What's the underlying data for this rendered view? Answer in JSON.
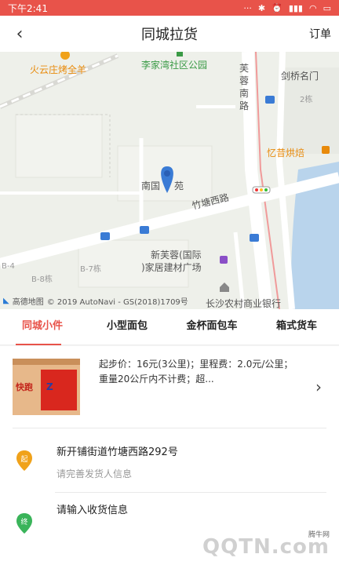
{
  "status": {
    "time": "下午2:41"
  },
  "nav": {
    "title": "同城拉货",
    "orders": "订单"
  },
  "map": {
    "labels": {
      "huoyun": "火云庄烤全羊",
      "lijiawan": "李家湾社区公园",
      "furong": "芙",
      "rongnan": "蓉",
      "nan": "南",
      "lu": "路",
      "jianqiao": "剑桥名门",
      "two_dong": "2栋",
      "yixi": "忆昔烘焙",
      "nanguo": "南国",
      "yuan": "苑",
      "zhutang": "竹塘西路",
      "xinfurong1": "新芙蓉(国际",
      "xinfurong2": ")家居建材广场",
      "b8": "B-8栋",
      "b7": "B-7栋",
      "b4": "B-4",
      "changsha": "长沙农村商业银行"
    },
    "copyright": "© 2019 AutoNavi - GS(2018)1709号",
    "logo_text": "高德地图"
  },
  "tabs": [
    "同城小件",
    "小型面包",
    "金杯面包车",
    "箱式货车"
  ],
  "vehicle": {
    "description": "起步价：16元(3公里)；里程费：2.0元/公里；重量20公斤内不计费；超...",
    "image_text": "快跑"
  },
  "pickup": {
    "badge": "起",
    "address": "新开铺街道竹塘西路292号",
    "hint": "请完善发货人信息"
  },
  "dropoff": {
    "badge": "终",
    "hint": "请输入收货信息"
  },
  "watermark": {
    "small": "腾牛网",
    "big": "QQTN.com"
  },
  "colors": {
    "accent": "#e8534a",
    "pickup": "#f0a21a",
    "dropoff": "#3ab45a"
  }
}
